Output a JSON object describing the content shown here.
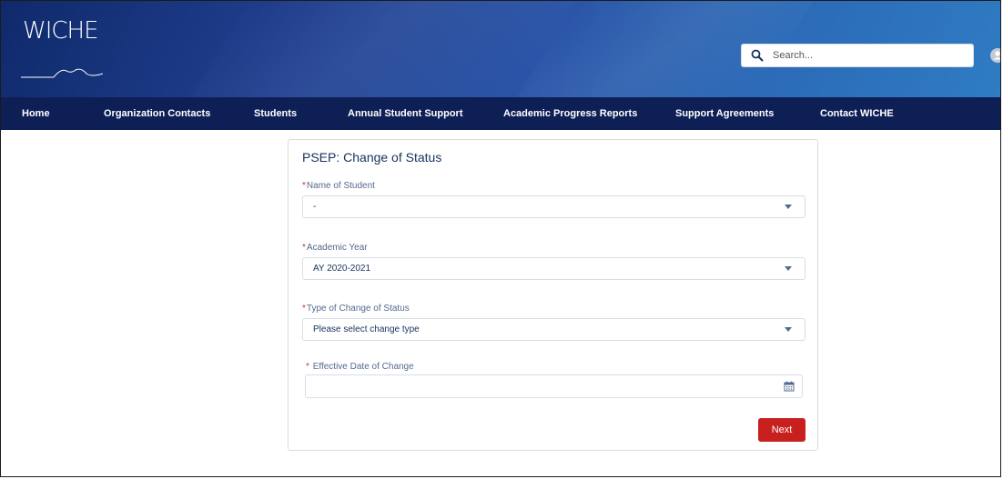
{
  "header": {
    "logo_text": "WICHE",
    "search": {
      "placeholder": "Search..."
    }
  },
  "nav": {
    "items": [
      {
        "label": "Home"
      },
      {
        "label": "Organization Contacts"
      },
      {
        "label": "Students"
      },
      {
        "label": "Annual Student Support"
      },
      {
        "label": "Academic Progress Reports"
      },
      {
        "label": "Support Agreements"
      },
      {
        "label": "Contact WICHE"
      }
    ]
  },
  "form": {
    "title": "PSEP: Change of Status",
    "required_marker": "*",
    "fields": [
      {
        "label": "Name of Student",
        "value": "-"
      },
      {
        "label": "Academic Year",
        "value": "AY 2020-2021"
      },
      {
        "label": "Type of Change of Status",
        "value": "Please select change type"
      },
      {
        "label": "Effective Date of Change",
        "value": ""
      }
    ],
    "next_label": "Next"
  },
  "icons": {
    "search": "search-icon",
    "dropdown": "chevron-down-icon",
    "calendar": "calendar-icon",
    "avatar": "user-icon"
  },
  "colors": {
    "nav_bg": "#0e1f56",
    "accent_button": "#c8201f",
    "required": "#c23934"
  }
}
